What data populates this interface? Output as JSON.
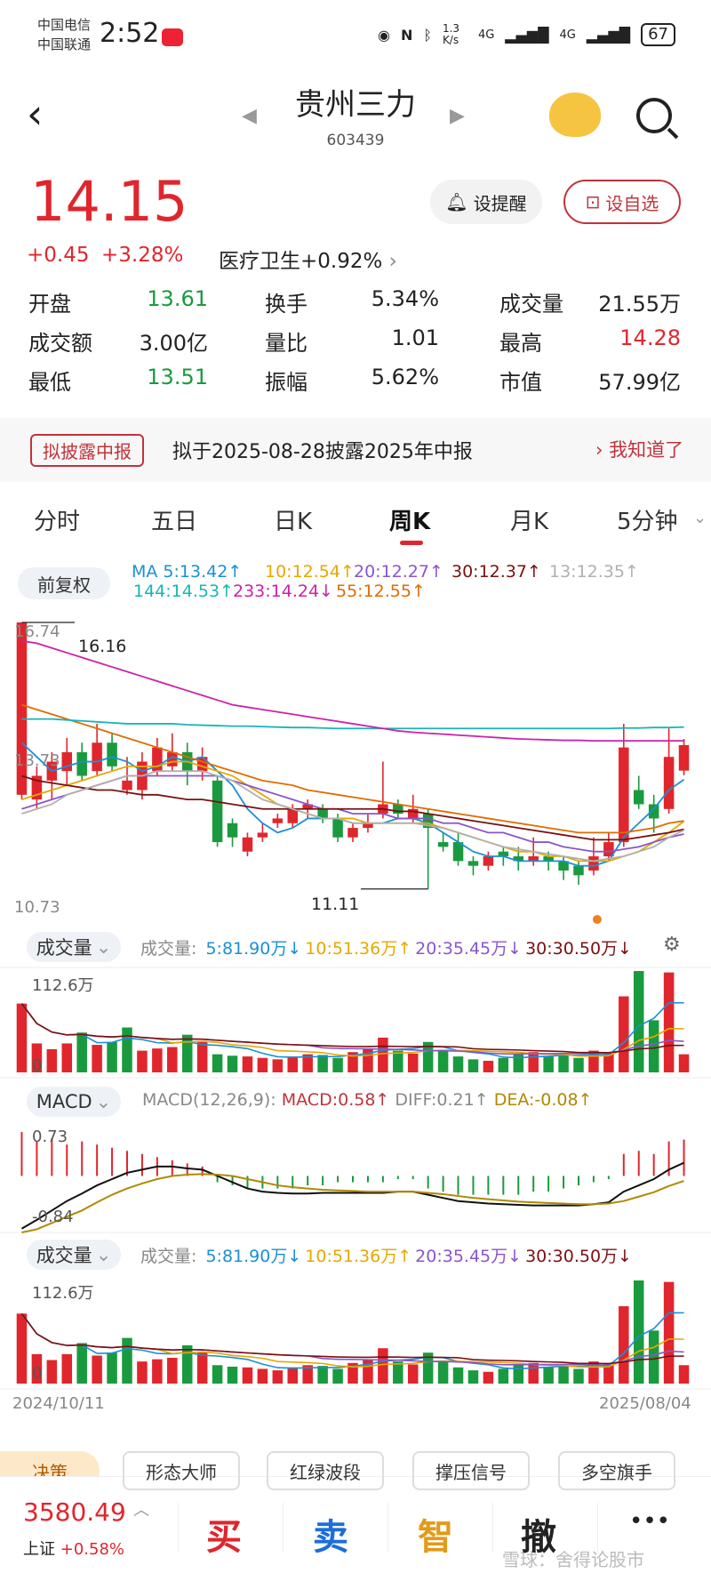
{
  "status": {
    "carrier1": "中国电信",
    "carrier2": "中国联通",
    "time": "2:52",
    "net_speed": "1.3 K/s",
    "sig1": "4G",
    "sig2": "4G",
    "battery": "67"
  },
  "header": {
    "title": "贵州三力",
    "code": "603439"
  },
  "quote": {
    "price": "14.15",
    "change": "+0.45",
    "change_pct": "+3.28%",
    "sector": "医疗卫生+0.92%",
    "alert_label": "设提醒",
    "fav_label": "设自选",
    "stats": [
      {
        "label": "开盘",
        "value": "13.61",
        "color": "#1a9a3e"
      },
      {
        "label": "换手",
        "value": "5.34%",
        "color": "#222222"
      },
      {
        "label": "成交量",
        "value": "21.55万",
        "color": "#222222"
      },
      {
        "label": "成交额",
        "value": "3.00亿",
        "color": "#222222"
      },
      {
        "label": "量比",
        "value": "1.01",
        "color": "#222222"
      },
      {
        "label": "最高",
        "value": "14.28",
        "color": "#e0262c"
      },
      {
        "label": "最低",
        "value": "13.51",
        "color": "#1a9a3e"
      },
      {
        "label": "振幅",
        "value": "5.62%",
        "color": "#222222"
      },
      {
        "label": "市值",
        "value": "57.99亿",
        "color": "#222222"
      }
    ]
  },
  "notice": {
    "tag": "拟披露中报",
    "text": "拟于2025-08-28披露2025年中报",
    "button": "我知道了"
  },
  "tabs": [
    "分时",
    "五日",
    "日K",
    "周K",
    "月K",
    "5分钟"
  ],
  "active_tab": "周K",
  "kline": {
    "adjust_label": "前复权",
    "ma_items": [
      {
        "text": "MA 5:13.42↑",
        "color": "#1b8fd6"
      },
      {
        "text": "10:12.54↑",
        "color": "#e6a700"
      },
      {
        "text": "20:12.27↑",
        "color": "#8a55cc"
      },
      {
        "text": "30:12.37↑",
        "color": "#7a1010"
      },
      {
        "text": "13:12.35↑",
        "color": "#b0b0b0"
      },
      {
        "text": "144:14.53↑",
        "color": "#18b5b5"
      },
      {
        "text": "233:14.24↓",
        "color": "#cc22aa"
      },
      {
        "text": "55:12.55↑",
        "color": "#e06b00"
      }
    ],
    "axis_top": "16.74",
    "axis_mid": "13.73",
    "axis_bottom": "10.73",
    "label_high": "16.16",
    "label_low": "11.11"
  },
  "volume1": {
    "button": "成交量",
    "legend": [
      {
        "text": "成交量: ",
        "color": "#888888"
      },
      {
        "text": "5:81.90万↓",
        "color": "#1b8fd6"
      },
      {
        "text": "10:51.36万↑",
        "color": "#e6a700"
      },
      {
        "text": "20:35.45万↓",
        "color": "#8a55cc"
      },
      {
        "text": "30:30.50万↓",
        "color": "#7a1010"
      }
    ],
    "axis_top": "112.6万",
    "axis_zero": "0"
  },
  "macd": {
    "button": "MACD",
    "params": "MACD(12,26,9):",
    "macd_val": "MACD:0.58↑",
    "diff_val": "DIFF:0.21↑",
    "dea_val": "DEA:-0.08↑",
    "axis_top": "0.73",
    "axis_bottom": "-0.84"
  },
  "volume2": {
    "button": "成交量",
    "legend": [
      {
        "text": "成交量: ",
        "color": "#888888"
      },
      {
        "text": "5:81.90万↓",
        "color": "#1b8fd6"
      },
      {
        "text": "10:51.36万↑",
        "color": "#e6a700"
      },
      {
        "text": "20:35.45万↓",
        "color": "#8a55cc"
      },
      {
        "text": "30:30.50万↓",
        "color": "#7a1010"
      }
    ],
    "axis_top": "112.6万",
    "axis_zero": "0",
    "date_start": "2024/10/11",
    "date_end": "2025/08/04"
  },
  "tools": [
    "形态大师",
    "红绿波段",
    "撑压信号",
    "多空旗手"
  ],
  "decision_label": "决策",
  "bottom": {
    "index_value": "3580.49",
    "index_name": "上证",
    "index_change": "+0.58%",
    "actions": [
      {
        "label": "买",
        "color": "#e0262c"
      },
      {
        "label": "卖",
        "color": "#1b6fd6"
      },
      {
        "label": "智",
        "color": "#e39a1a"
      },
      {
        "label": "撤",
        "color": "#222222"
      }
    ],
    "more": "•••",
    "watermark": "雪球：舍得论股市"
  },
  "chart_data": {
    "type": "candlestick",
    "x_range": [
      "2024/10/11",
      "2025/08/04"
    ],
    "ylim": [
      10.73,
      16.74
    ],
    "candles": [
      {
        "o": 13.1,
        "c": 16.74,
        "h": 16.74,
        "l": 13.0
      },
      {
        "o": 13.0,
        "c": 13.5,
        "h": 13.7,
        "l": 12.8
      },
      {
        "o": 13.4,
        "c": 13.8,
        "h": 14.0,
        "l": 13.0
      },
      {
        "o": 13.6,
        "c": 14.0,
        "h": 14.3,
        "l": 13.3
      },
      {
        "o": 14.0,
        "c": 13.5,
        "h": 14.2,
        "l": 13.4
      },
      {
        "o": 13.6,
        "c": 14.2,
        "h": 14.6,
        "l": 13.5
      },
      {
        "o": 14.2,
        "c": 13.7,
        "h": 14.4,
        "l": 13.6
      },
      {
        "o": 13.2,
        "c": 13.4,
        "h": 13.9,
        "l": 13.1
      },
      {
        "o": 13.2,
        "c": 13.8,
        "h": 14.0,
        "l": 13.0
      },
      {
        "o": 13.6,
        "c": 14.1,
        "h": 14.3,
        "l": 13.5
      },
      {
        "o": 13.7,
        "c": 14.0,
        "h": 14.4,
        "l": 13.6
      },
      {
        "o": 14.0,
        "c": 13.6,
        "h": 14.2,
        "l": 13.3
      },
      {
        "o": 13.6,
        "c": 13.9,
        "h": 14.1,
        "l": 13.4
      },
      {
        "o": 13.4,
        "c": 12.1,
        "h": 13.5,
        "l": 12.0
      },
      {
        "o": 12.5,
        "c": 12.2,
        "h": 12.6,
        "l": 12.0
      },
      {
        "o": 11.9,
        "c": 12.2,
        "h": 12.3,
        "l": 11.8
      },
      {
        "o": 12.2,
        "c": 12.3,
        "h": 12.5,
        "l": 12.1
      },
      {
        "o": 12.5,
        "c": 12.6,
        "h": 12.7,
        "l": 12.4
      },
      {
        "o": 12.5,
        "c": 12.8,
        "h": 12.9,
        "l": 12.4
      },
      {
        "o": 12.8,
        "c": 12.9,
        "h": 13.0,
        "l": 12.6
      },
      {
        "o": 12.8,
        "c": 12.6,
        "h": 12.9,
        "l": 12.5
      },
      {
        "o": 12.6,
        "c": 12.2,
        "h": 12.7,
        "l": 12.1
      },
      {
        "o": 12.2,
        "c": 12.4,
        "h": 12.5,
        "l": 12.1
      },
      {
        "o": 12.4,
        "c": 12.5,
        "h": 12.7,
        "l": 12.3
      },
      {
        "o": 12.7,
        "c": 12.9,
        "h": 13.8,
        "l": 12.6
      },
      {
        "o": 12.9,
        "c": 12.7,
        "h": 13.0,
        "l": 12.6
      },
      {
        "o": 12.6,
        "c": 12.8,
        "h": 13.1,
        "l": 12.5
      },
      {
        "o": 12.7,
        "c": 12.4,
        "h": 12.8,
        "l": 11.11
      },
      {
        "o": 12.1,
        "c": 12.0,
        "h": 12.3,
        "l": 11.9
      },
      {
        "o": 12.1,
        "c": 11.7,
        "h": 12.3,
        "l": 11.6
      },
      {
        "o": 11.7,
        "c": 11.6,
        "h": 11.8,
        "l": 11.4
      },
      {
        "o": 11.6,
        "c": 11.8,
        "h": 11.9,
        "l": 11.5
      },
      {
        "o": 11.9,
        "c": 11.8,
        "h": 12.0,
        "l": 11.6
      },
      {
        "o": 11.8,
        "c": 11.7,
        "h": 12.0,
        "l": 11.5
      },
      {
        "o": 11.7,
        "c": 11.8,
        "h": 12.2,
        "l": 11.6
      },
      {
        "o": 11.8,
        "c": 11.7,
        "h": 11.9,
        "l": 11.5
      },
      {
        "o": 11.7,
        "c": 11.5,
        "h": 11.8,
        "l": 11.3
      },
      {
        "o": 11.6,
        "c": 11.4,
        "h": 11.7,
        "l": 11.2
      },
      {
        "o": 11.5,
        "c": 11.8,
        "h": 12.2,
        "l": 11.4
      },
      {
        "o": 11.8,
        "c": 12.1,
        "h": 12.3,
        "l": 11.7
      },
      {
        "o": 12.1,
        "c": 14.1,
        "h": 14.6,
        "l": 12.0
      },
      {
        "o": 13.2,
        "c": 12.9,
        "h": 13.5,
        "l": 12.8
      },
      {
        "o": 12.9,
        "c": 12.6,
        "h": 13.1,
        "l": 12.3
      },
      {
        "o": 12.8,
        "c": 13.9,
        "h": 14.5,
        "l": 12.7
      },
      {
        "o": 13.61,
        "c": 14.15,
        "h": 14.28,
        "l": 13.51
      }
    ],
    "volumes": [
      95,
      40,
      32,
      40,
      55,
      38,
      42,
      62,
      30,
      33,
      35,
      52,
      42,
      25,
      23,
      22,
      20,
      18,
      22,
      25,
      24,
      20,
      28,
      33,
      48,
      30,
      26,
      42,
      30,
      22,
      18,
      16,
      20,
      25,
      28,
      22,
      24,
      20,
      30,
      26,
      105,
      140,
      72,
      138,
      25
    ],
    "vol_up": [
      1,
      1,
      1,
      1,
      0,
      1,
      0,
      0,
      1,
      1,
      1,
      0,
      1,
      0,
      0,
      1,
      1,
      1,
      1,
      1,
      0,
      0,
      1,
      1,
      1,
      0,
      1,
      0,
      0,
      0,
      0,
      1,
      0,
      0,
      1,
      0,
      0,
      0,
      1,
      1,
      1,
      0,
      0,
      1,
      1
    ],
    "ma5": [
      14.2,
      13.9,
      13.6,
      13.7,
      13.8,
      13.8,
      13.9,
      13.8,
      13.6,
      13.7,
      13.9,
      13.8,
      13.9,
      13.6,
      13.3,
      12.8,
      12.5,
      12.3,
      12.4,
      12.6,
      12.6,
      12.6,
      12.5,
      12.5,
      12.5,
      12.6,
      12.6,
      12.5,
      12.3,
      12.1,
      11.9,
      11.8,
      11.8,
      11.7,
      11.7,
      11.7,
      11.7,
      11.6,
      11.6,
      11.7,
      12.2,
      12.5,
      12.8,
      13.2,
      13.42
    ],
    "ma10": [
      13.0,
      13.1,
      13.2,
      13.3,
      13.4,
      13.5,
      13.6,
      13.7,
      13.7,
      13.7,
      13.8,
      13.8,
      13.7,
      13.6,
      13.5,
      13.3,
      13.1,
      12.9,
      12.8,
      12.7,
      12.6,
      12.6,
      12.6,
      12.5,
      12.5,
      12.5,
      12.5,
      12.5,
      12.4,
      12.3,
      12.2,
      12.1,
      12.0,
      11.9,
      11.9,
      11.8,
      11.8,
      11.7,
      11.7,
      11.7,
      11.8,
      11.9,
      12.1,
      12.3,
      12.54
    ],
    "ma20": [
      12.8,
      12.9,
      13.0,
      13.1,
      13.2,
      13.3,
      13.4,
      13.5,
      13.5,
      13.5,
      13.5,
      13.5,
      13.5,
      13.5,
      13.4,
      13.3,
      13.2,
      13.1,
      13.0,
      12.9,
      12.8,
      12.8,
      12.7,
      12.7,
      12.7,
      12.6,
      12.6,
      12.6,
      12.5,
      12.5,
      12.4,
      12.3,
      12.3,
      12.2,
      12.1,
      12.1,
      12.0,
      11.95,
      11.9,
      11.9,
      11.95,
      12.0,
      12.1,
      12.2,
      12.27
    ],
    "ma30": [
      13.5,
      13.4,
      13.35,
      13.3,
      13.25,
      13.2,
      13.2,
      13.15,
      13.1,
      13.1,
      13.05,
      13.0,
      13.0,
      12.95,
      12.9,
      12.85,
      12.8,
      12.8,
      12.8,
      12.8,
      12.8,
      12.8,
      12.8,
      12.8,
      12.8,
      12.75,
      12.75,
      12.7,
      12.65,
      12.6,
      12.55,
      12.5,
      12.45,
      12.4,
      12.35,
      12.3,
      12.25,
      12.2,
      12.15,
      12.15,
      12.15,
      12.2,
      12.25,
      12.3,
      12.37
    ],
    "ma13": [
      12.7,
      12.8,
      12.9,
      13.1,
      13.2,
      13.3,
      13.4,
      13.5,
      13.5,
      13.6,
      13.6,
      13.6,
      13.6,
      13.5,
      13.4,
      13.2,
      13.0,
      12.9,
      12.8,
      12.7,
      12.6,
      12.6,
      12.5,
      12.5,
      12.5,
      12.5,
      12.5,
      12.45,
      12.4,
      12.3,
      12.2,
      12.1,
      12.0,
      11.95,
      11.9,
      11.85,
      11.8,
      11.75,
      11.7,
      11.75,
      11.8,
      11.9,
      12.0,
      12.2,
      12.35
    ],
    "ma55": [
      15.0,
      14.9,
      14.8,
      14.7,
      14.6,
      14.5,
      14.4,
      14.3,
      14.2,
      14.1,
      14.0,
      13.9,
      13.8,
      13.7,
      13.6,
      13.5,
      13.4,
      13.35,
      13.3,
      13.2,
      13.15,
      13.1,
      13.05,
      13.0,
      12.95,
      12.9,
      12.85,
      12.8,
      12.75,
      12.7,
      12.65,
      12.6,
      12.55,
      12.5,
      12.45,
      12.4,
      12.35,
      12.3,
      12.3,
      12.3,
      12.3,
      12.35,
      12.4,
      12.5,
      12.55
    ],
    "ma144": [
      14.7,
      14.7,
      14.7,
      14.68,
      14.66,
      14.64,
      14.62,
      14.6,
      14.6,
      14.6,
      14.6,
      14.58,
      14.57,
      14.56,
      14.55,
      14.55,
      14.54,
      14.53,
      14.52,
      14.52,
      14.51,
      14.5,
      14.5,
      14.5,
      14.5,
      14.5,
      14.5,
      14.5,
      14.5,
      14.5,
      14.5,
      14.5,
      14.5,
      14.5,
      14.5,
      14.5,
      14.5,
      14.5,
      14.5,
      14.5,
      14.51,
      14.51,
      14.52,
      14.52,
      14.53
    ],
    "ma233": [
      16.35,
      16.3,
      16.2,
      16.1,
      16.0,
      15.9,
      15.8,
      15.7,
      15.6,
      15.5,
      15.4,
      15.3,
      15.2,
      15.1,
      15.0,
      14.95,
      14.9,
      14.85,
      14.8,
      14.75,
      14.7,
      14.65,
      14.6,
      14.55,
      14.5,
      14.45,
      14.42,
      14.4,
      14.38,
      14.36,
      14.34,
      14.32,
      14.3,
      14.28,
      14.27,
      14.26,
      14.25,
      14.25,
      14.24,
      14.24,
      14.24,
      14.24,
      14.24,
      14.24,
      14.24
    ],
    "macd_hist": [
      0.7,
      0.55,
      0.6,
      0.5,
      0.55,
      0.5,
      0.45,
      0.4,
      0.35,
      0.3,
      0.25,
      0.2,
      0.15,
      -0.1,
      -0.15,
      -0.2,
      -0.2,
      -0.2,
      -0.2,
      -0.15,
      -0.15,
      -0.1,
      -0.1,
      -0.1,
      -0.1,
      -0.05,
      -0.05,
      -0.2,
      -0.25,
      -0.3,
      -0.3,
      -0.3,
      -0.3,
      -0.3,
      -0.25,
      -0.25,
      -0.2,
      -0.15,
      -0.1,
      -0.05,
      0.35,
      0.4,
      0.35,
      0.55,
      0.58
    ],
    "macd_diff": [
      -0.84,
      -0.7,
      -0.55,
      -0.4,
      -0.28,
      -0.15,
      -0.05,
      0.05,
      0.1,
      0.15,
      0.15,
      0.12,
      0.1,
      0.0,
      -0.1,
      -0.2,
      -0.25,
      -0.27,
      -0.28,
      -0.28,
      -0.27,
      -0.27,
      -0.27,
      -0.27,
      -0.27,
      -0.25,
      -0.25,
      -0.3,
      -0.35,
      -0.4,
      -0.42,
      -0.44,
      -0.45,
      -0.46,
      -0.47,
      -0.47,
      -0.47,
      -0.47,
      -0.45,
      -0.42,
      -0.25,
      -0.15,
      -0.05,
      0.1,
      0.21
    ],
    "macd_dea": [
      -0.9,
      -0.85,
      -0.75,
      -0.65,
      -0.55,
      -0.42,
      -0.3,
      -0.2,
      -0.12,
      -0.05,
      0.0,
      0.02,
      0.03,
      0.02,
      0.0,
      -0.05,
      -0.1,
      -0.15,
      -0.18,
      -0.2,
      -0.22,
      -0.23,
      -0.24,
      -0.25,
      -0.25,
      -0.25,
      -0.25,
      -0.27,
      -0.29,
      -0.32,
      -0.35,
      -0.37,
      -0.39,
      -0.41,
      -0.42,
      -0.43,
      -0.44,
      -0.45,
      -0.45,
      -0.44,
      -0.4,
      -0.33,
      -0.26,
      -0.16,
      -0.08
    ]
  }
}
